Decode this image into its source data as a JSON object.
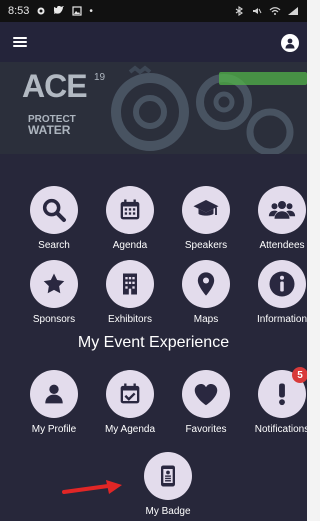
{
  "status_bar": {
    "time": "8:53"
  },
  "banner": {
    "logo": "ACE",
    "logo_super": "19",
    "subtitle_line1": "PROTECT",
    "subtitle_line2": "WATER"
  },
  "grid1": [
    {
      "label": "Search",
      "icon": "search-icon"
    },
    {
      "label": "Agenda",
      "icon": "calendar-icon"
    },
    {
      "label": "Speakers",
      "icon": "graduation-cap-icon"
    },
    {
      "label": "Attendees",
      "icon": "people-icon"
    },
    {
      "label": "Sponsors",
      "icon": "star-icon"
    },
    {
      "label": "Exhibitors",
      "icon": "building-icon"
    },
    {
      "label": "Maps",
      "icon": "map-pin-icon"
    },
    {
      "label": "Information",
      "icon": "info-icon"
    }
  ],
  "section_title": "My Event Experience",
  "grid2": [
    {
      "label": "My Profile",
      "icon": "person-icon"
    },
    {
      "label": "My Agenda",
      "icon": "calendar-check-icon"
    },
    {
      "label": "Favorites",
      "icon": "heart-icon"
    },
    {
      "label": "Notifications",
      "icon": "exclamation-icon",
      "badge": "5"
    }
  ],
  "grid3": [
    {
      "label": "My Badge",
      "icon": "badge-icon"
    }
  ],
  "colors": {
    "background": "#27273a",
    "tile": "#e3dcec",
    "icon": "#2a2840",
    "badge": "#d83a3a",
    "arrow": "#e12626"
  }
}
